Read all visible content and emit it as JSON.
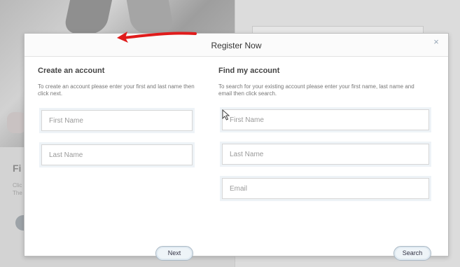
{
  "background": {
    "heading_partial": "Fi",
    "line1_partial": "Clic",
    "line2_partial": "The"
  },
  "modal": {
    "title": "Register Now",
    "close_glyph": "×"
  },
  "create_account": {
    "title": "Create an account",
    "description": "To create an account please enter your first and last name then click next.",
    "first_name_placeholder": "First Name",
    "last_name_placeholder": "Last Name",
    "next_label": "Next"
  },
  "find_account": {
    "title": "Find my account",
    "description": "To search for your existing account please enter your first name, last name and email then click search.",
    "first_name_placeholder": "First Name",
    "last_name_placeholder": "Last Name",
    "email_placeholder": "Email",
    "search_label": "Search"
  },
  "annotation": {
    "arrow_color": "#e01b1b"
  },
  "colors": {
    "button_fill": "#eef4f8",
    "button_border": "#aab8c4",
    "close_icon": "#9aa9b8"
  }
}
